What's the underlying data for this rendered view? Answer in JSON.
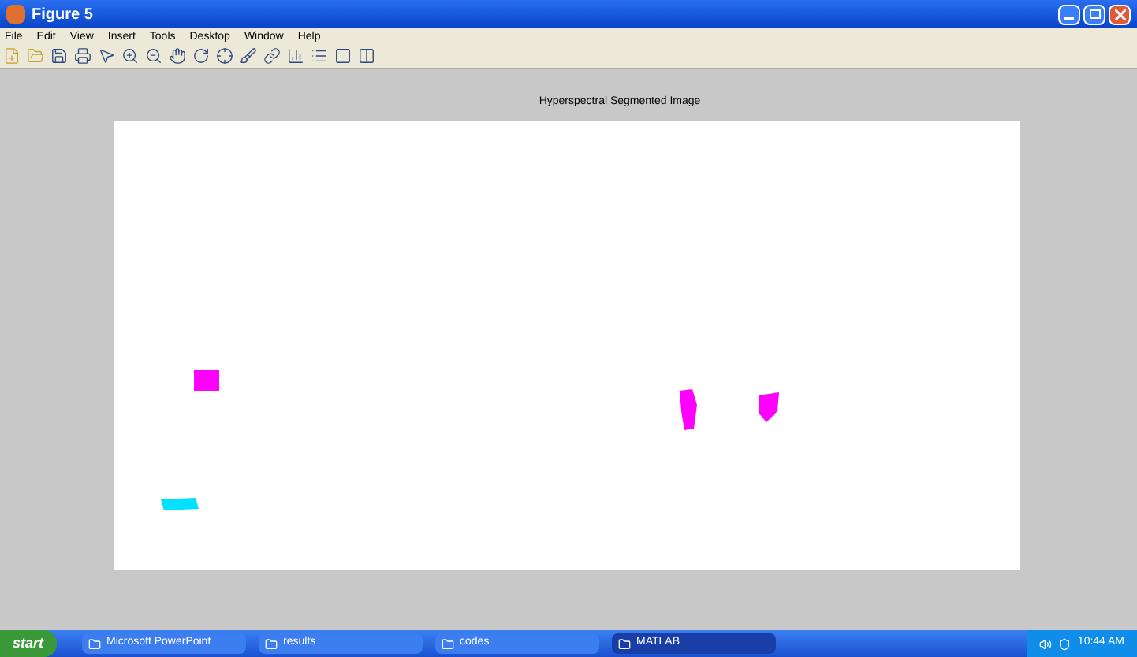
{
  "window": {
    "title": "Figure 5"
  },
  "menu": [
    "File",
    "Edit",
    "View",
    "Insert",
    "Tools",
    "Desktop",
    "Window",
    "Help"
  ],
  "axes": {
    "title": "Hyperspectral Segmented Image"
  },
  "taskbar": {
    "start": "start",
    "items": [
      {
        "label": "Microsoft PowerPoint",
        "selected": false
      },
      {
        "label": "results",
        "selected": false
      },
      {
        "label": "codes",
        "selected": false
      },
      {
        "label": "MATLAB",
        "selected": true
      }
    ],
    "clock": "10:44 AM"
  }
}
